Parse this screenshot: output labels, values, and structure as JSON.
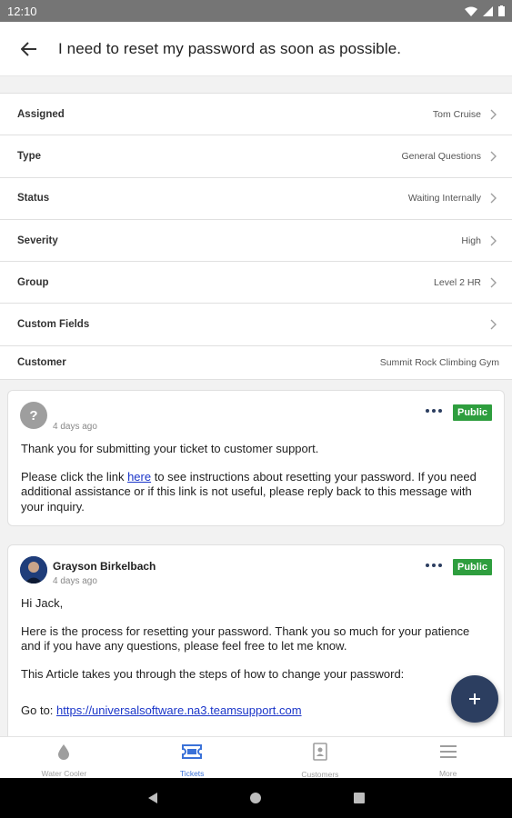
{
  "status_bar": {
    "time": "12:10"
  },
  "app_bar": {
    "title": "I need to reset my password as soon as possible."
  },
  "fields": [
    {
      "label": "Assigned",
      "value": "Tom Cruise",
      "chevron": true
    },
    {
      "label": "Type",
      "value": "General Questions",
      "chevron": true
    },
    {
      "label": "Status",
      "value": "Waiting Internally",
      "chevron": true
    },
    {
      "label": "Severity",
      "value": "High",
      "chevron": true
    },
    {
      "label": "Group",
      "value": "Level 2 HR",
      "chevron": true
    },
    {
      "label": "Custom Fields",
      "value": "",
      "chevron": true
    },
    {
      "label": "Customer",
      "value": "Summit Rock Climbing Gym",
      "chevron": false
    }
  ],
  "messages": [
    {
      "avatar": "?",
      "author": "",
      "time": "4 days ago",
      "badge": "Public",
      "p1": "Thank you for submitting your ticket to customer support.",
      "p2_pre": "Please click the link ",
      "p2_link": "here",
      "p2_post": " to see instructions about resetting your password. If you need additional assistance or if this link is not useful, please reply back to this message with your inquiry."
    },
    {
      "author": "Grayson Birkelbach",
      "time": "4 days ago",
      "badge": "Public",
      "p1": "Hi Jack,",
      "p2": "Here is the process for resetting your password. Thank you so much for your patience and if you have any questions, please feel free to let me know.",
      "p3": "This Article takes you through the steps of how to change your password:",
      "p4_pre": "Go to: ",
      "p4_link": "https://universalsoftware.na3.teamsupport.com "
    }
  ],
  "fab": {
    "icon": "plus-icon"
  },
  "bottom_nav": [
    {
      "label": "Water Cooler",
      "icon": "water-drop-icon"
    },
    {
      "label": "Tickets",
      "icon": "ticket-icon",
      "active": true
    },
    {
      "label": "Customers",
      "icon": "contact-card-icon"
    },
    {
      "label": "More",
      "icon": "menu-icon"
    }
  ],
  "colors": {
    "accent": "#3b72d8",
    "fab": "#2c3e60",
    "badge": "#2e9e3e",
    "link": "#1a35c9"
  }
}
